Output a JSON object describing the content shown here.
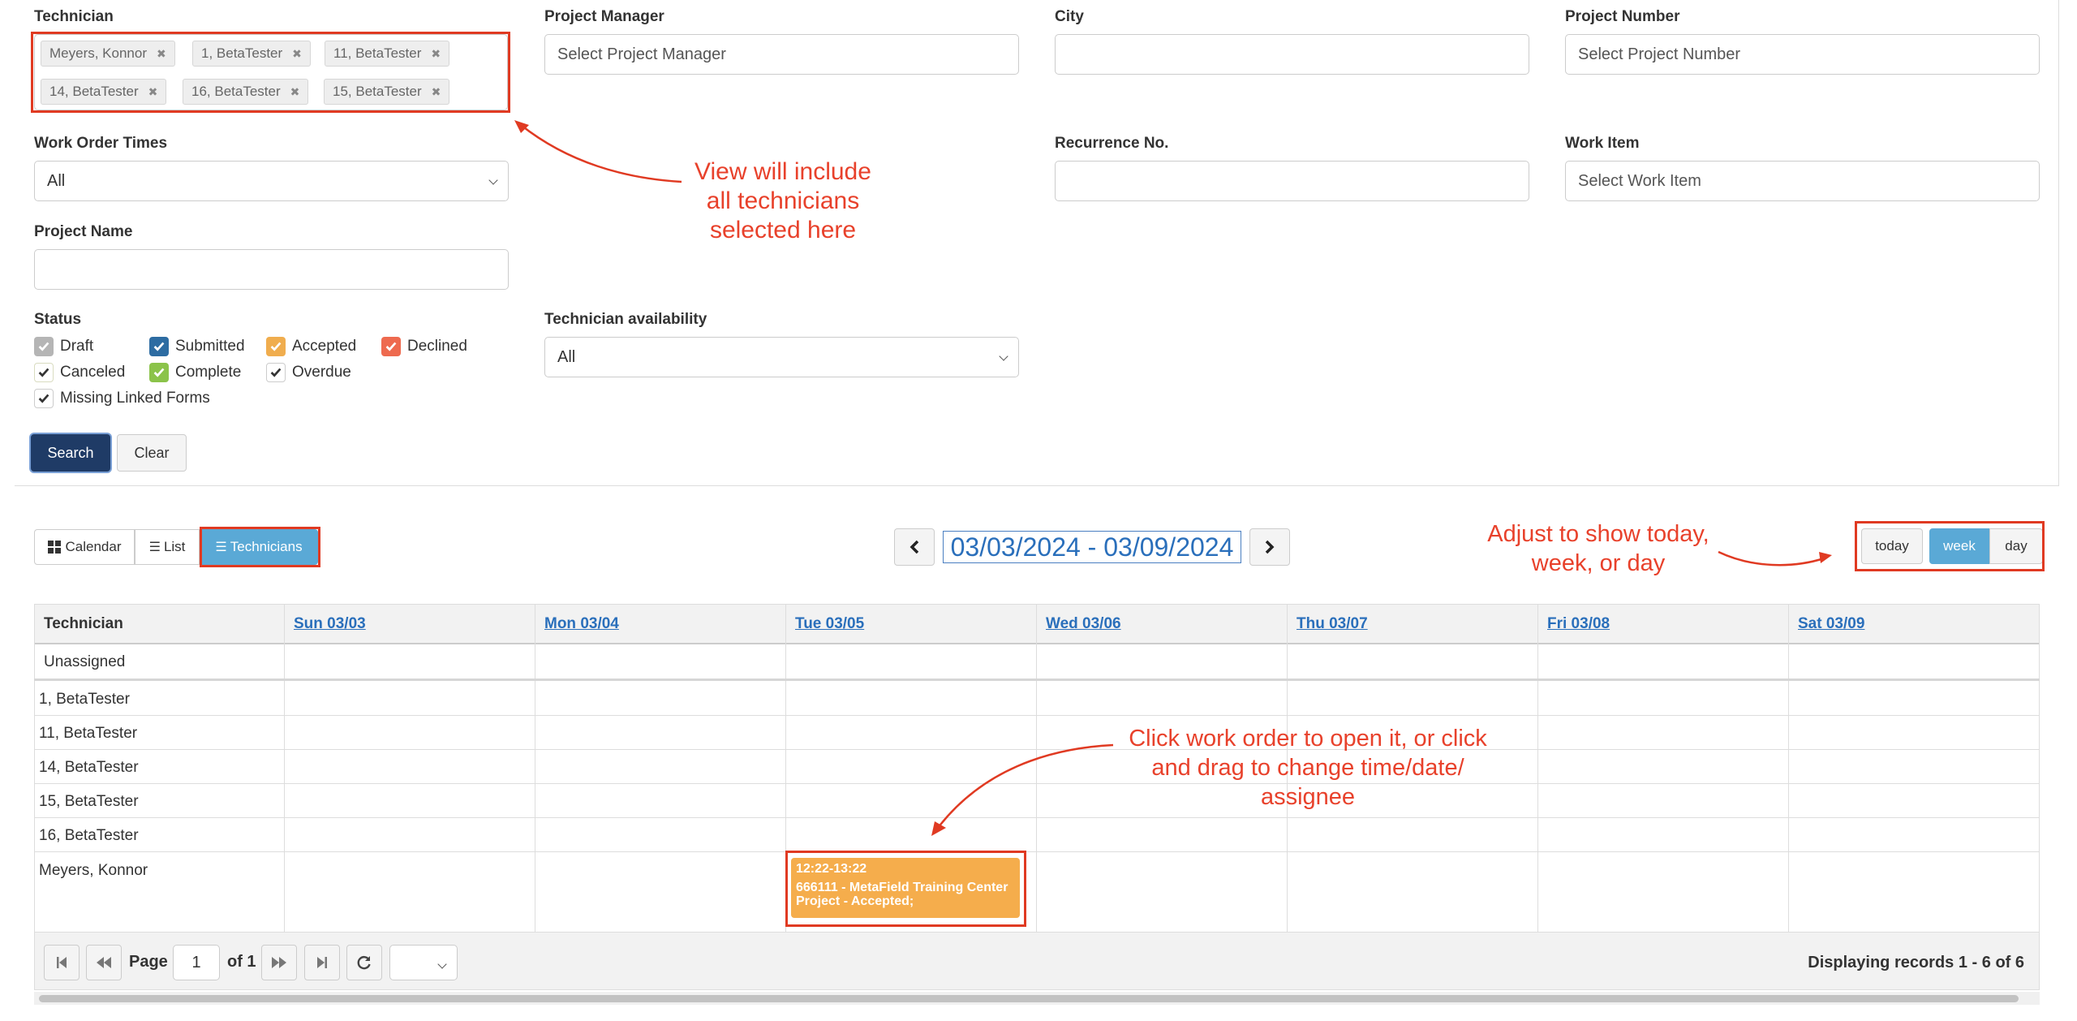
{
  "filters": {
    "technician": {
      "label": "Technician",
      "tags": [
        "Meyers, Konnor",
        "1, BetaTester",
        "11, BetaTester",
        "14, BetaTester",
        "16, BetaTester",
        "15, BetaTester"
      ]
    },
    "project_manager": {
      "label": "Project Manager",
      "placeholder": "Select Project Manager"
    },
    "city": {
      "label": "City",
      "value": ""
    },
    "project_number": {
      "label": "Project Number",
      "placeholder": "Select Project Number"
    },
    "work_order_times": {
      "label": "Work Order Times",
      "value": "All"
    },
    "recurrence_no": {
      "label": "Recurrence No.",
      "value": ""
    },
    "work_item": {
      "label": "Work Item",
      "placeholder": "Select Work Item"
    },
    "project_name": {
      "label": "Project Name",
      "value": ""
    },
    "status": {
      "label": "Status",
      "options": [
        {
          "label": "Draft",
          "color": "#b5b5b5"
        },
        {
          "label": "Submitted",
          "color": "#2d6ca2"
        },
        {
          "label": "Accepted",
          "color": "#f0ad4e"
        },
        {
          "label": "Declined",
          "color": "#ee6a4f"
        },
        {
          "label": "Canceled",
          "color": "#ffffff"
        },
        {
          "label": "Complete",
          "color": "#8bc34a"
        },
        {
          "label": "Overdue",
          "color": "#ffffff"
        },
        {
          "label": "Missing Linked Forms",
          "color": "#ffffff"
        }
      ]
    },
    "technician_availability": {
      "label": "Technician availability",
      "value": "All"
    },
    "search_label": "Search",
    "clear_label": "Clear"
  },
  "annotations": {
    "technicians": "View will include\nall technicians\nselected here",
    "view_mode": "Adjust to show today,\nweek, or day",
    "work_order": "Click work order to open it, or click\nand drag to change time/date/\nassignee"
  },
  "toolbar": {
    "views": [
      "Calendar",
      "List",
      "Technicians"
    ],
    "date_range": "03/03/2024 - 03/09/2024",
    "today_label": "today",
    "week_label": "week",
    "day_label": "day"
  },
  "grid": {
    "header_technician": "Technician",
    "days": [
      "Sun 03/03",
      "Mon 03/04",
      "Tue 03/05",
      "Wed 03/06",
      "Thu 03/07",
      "Fri 03/08",
      "Sat 03/09"
    ],
    "rows": [
      "Unassigned",
      "1, BetaTester",
      "11, BetaTester",
      "14, BetaTester",
      "15, BetaTester",
      "16, BetaTester",
      "Meyers, Konnor"
    ],
    "event": {
      "time": "12:22-13:22",
      "title": "666111 - MetaField Training Center Project - Accepted;",
      "color": "#f5ad4c"
    }
  },
  "pager": {
    "page_label": "Page",
    "page_value": "1",
    "of_label": "of 1",
    "records": "Displaying records 1 - 6 of 6"
  }
}
